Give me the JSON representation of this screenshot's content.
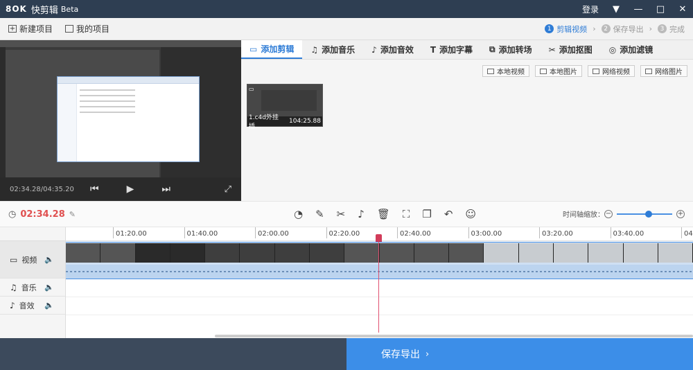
{
  "titlebar": {
    "logo": "8OK",
    "app_name": "快剪辑",
    "beta": "Beta",
    "login": "登录",
    "menu_icon": "triangle-down-icon",
    "minimize_icon": "minimize-icon",
    "maximize_icon": "maximize-icon",
    "close_icon": "close-icon"
  },
  "toolbar": {
    "new_project": "新建项目",
    "my_projects": "我的项目",
    "steps": [
      {
        "num": "1",
        "label": "剪辑视频"
      },
      {
        "num": "2",
        "label": "保存导出"
      },
      {
        "num": "3",
        "label": "完成"
      }
    ]
  },
  "preview": {
    "time": "02:34.28/04:35.20"
  },
  "tabs": [
    {
      "label": "添加剪辑",
      "icon": "camera-icon"
    },
    {
      "label": "添加音乐",
      "icon": "music-icon"
    },
    {
      "label": "添加音效",
      "icon": "sound-effect-icon"
    },
    {
      "label": "添加字幕",
      "icon": "text-icon"
    },
    {
      "label": "添加转场",
      "icon": "transition-icon"
    },
    {
      "label": "添加抠图",
      "icon": "cutout-icon"
    },
    {
      "label": "添加滤镜",
      "icon": "filter-icon"
    }
  ],
  "imports": {
    "local_video": "本地视频",
    "local_image": "本地图片",
    "web_video": "网络视频",
    "web_image": "网络图片"
  },
  "clip": {
    "name": "1.c4d外挂插...",
    "duration": "104:25.88"
  },
  "timeline_toolbar": {
    "current_time": "02:34.28",
    "zoom_label": "时间轴缩放：",
    "zoom_level": 0.58
  },
  "ruler": [
    "01:20.00",
    "01:40.00",
    "02:00.00",
    "02:20.00",
    "02:40.00",
    "03:00.00",
    "03:20.00",
    "03:40.00",
    "04:0"
  ],
  "tracks": {
    "video": "视频",
    "music": "音乐",
    "fx": "音效"
  },
  "export": {
    "label": "保存导出",
    "chevron": "›"
  }
}
